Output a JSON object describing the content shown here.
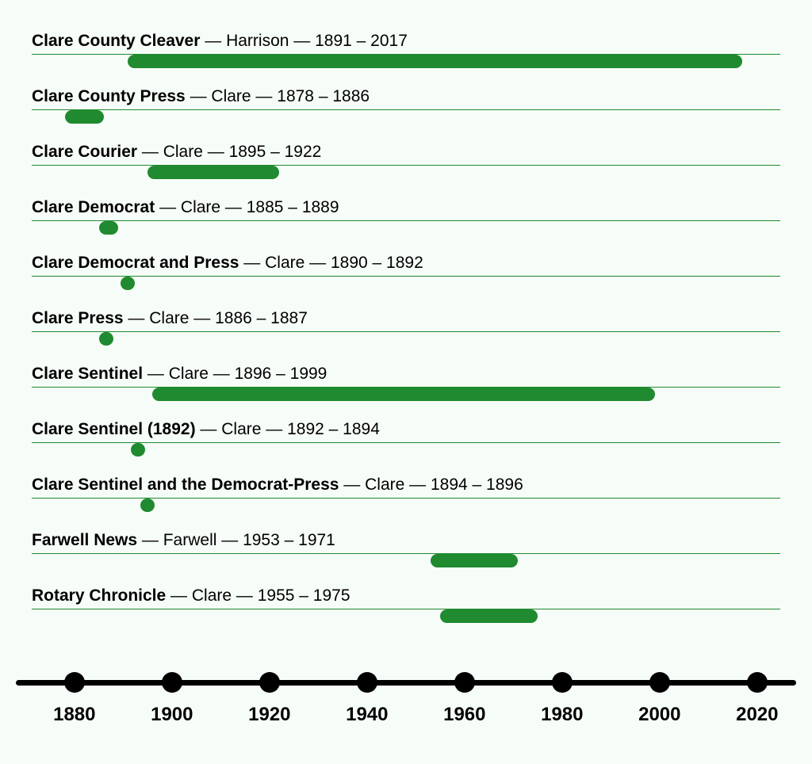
{
  "chart_data": {
    "type": "bar",
    "title": "",
    "xlabel": "",
    "ylabel": "",
    "xlim": [
      1868,
      2028
    ],
    "ticks": [
      1880,
      1900,
      1920,
      1940,
      1960,
      1980,
      2000,
      2020
    ],
    "series": [
      {
        "name": "Clare County Cleaver",
        "location": "Harrison",
        "start": 1891,
        "end": 2017
      },
      {
        "name": "Clare County Press",
        "location": "Clare",
        "start": 1878,
        "end": 1886
      },
      {
        "name": "Clare Courier",
        "location": "Clare",
        "start": 1895,
        "end": 1922
      },
      {
        "name": "Clare Democrat",
        "location": "Clare",
        "start": 1885,
        "end": 1889
      },
      {
        "name": "Clare Democrat and Press",
        "location": "Clare",
        "start": 1890,
        "end": 1892
      },
      {
        "name": "Clare Press",
        "location": "Clare",
        "start": 1886,
        "end": 1887
      },
      {
        "name": "Clare Sentinel",
        "location": "Clare",
        "start": 1896,
        "end": 1999
      },
      {
        "name": "Clare Sentinel (1892)",
        "location": "Clare",
        "start": 1892,
        "end": 1894
      },
      {
        "name": "Clare Sentinel and the Democrat-Press",
        "location": "Clare",
        "start": 1894,
        "end": 1896
      },
      {
        "name": "Farwell News",
        "location": "Farwell",
        "start": 1953,
        "end": 1971
      },
      {
        "name": "Rotary Chronicle",
        "location": "Clare",
        "start": 1955,
        "end": 1975
      }
    ]
  },
  "separator": " — ",
  "range_separator": " – "
}
